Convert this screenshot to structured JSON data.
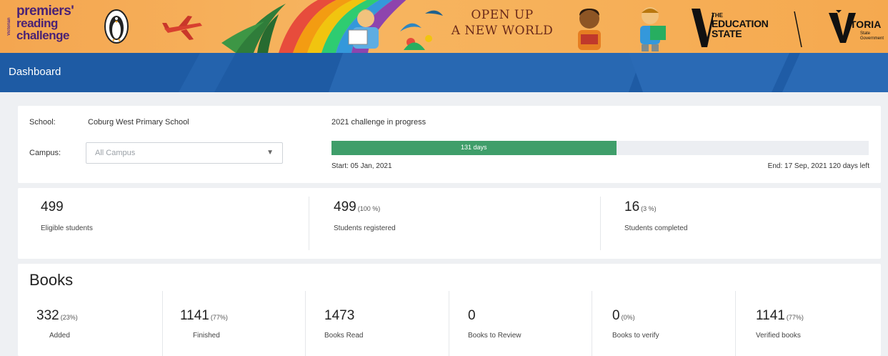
{
  "banner": {
    "brand_side": "Victorian",
    "brand_line1": "premiers'",
    "brand_line2": "reading",
    "brand_line3": "challenge",
    "tagline_line1": "OPEN UP",
    "tagline_line2": "A NEW WORLD",
    "edu_the": "THE",
    "edu_line1": "EDUCATION",
    "edu_line2": "STATE",
    "vic_name": "TORIA",
    "vic_sub": "State Government"
  },
  "header": {
    "title": "Dashboard"
  },
  "school": {
    "school_label": "School:",
    "school_value": "Coburg West Primary School",
    "campus_label": "Campus:",
    "campus_placeholder": "All Campus",
    "status": "2021 challenge in progress",
    "progress_label": "131 days",
    "progress_fraction": 0.53,
    "start": "Start: 05 Jan, 2021",
    "end": "End: 17 Sep, 2021 120 days left"
  },
  "stats": [
    {
      "value": "499",
      "sub": "",
      "caption": "Eligible students"
    },
    {
      "value": "499",
      "sub": "(100 %)",
      "caption": "Students registered"
    },
    {
      "value": "16",
      "sub": "(3 %)",
      "caption": "Students completed"
    }
  ],
  "books": {
    "title": "Books",
    "items": [
      {
        "value": "332",
        "sub": "(23%)",
        "caption": "Added"
      },
      {
        "value": "1141",
        "sub": "(77%)",
        "caption": "Finished"
      },
      {
        "value": "1473",
        "sub": "",
        "caption": "Books Read"
      },
      {
        "value": "0",
        "sub": "",
        "caption": "Books to Review"
      },
      {
        "value": "0",
        "sub": "(0%)",
        "caption": "Books to verify"
      },
      {
        "value": "1141",
        "sub": "(77%)",
        "caption": "Verified books"
      }
    ]
  },
  "colors": {
    "banner": "#f5a94f",
    "header": "#1e5ba4",
    "progress": "#3f9e6a",
    "brand_text": "#4a2275"
  }
}
